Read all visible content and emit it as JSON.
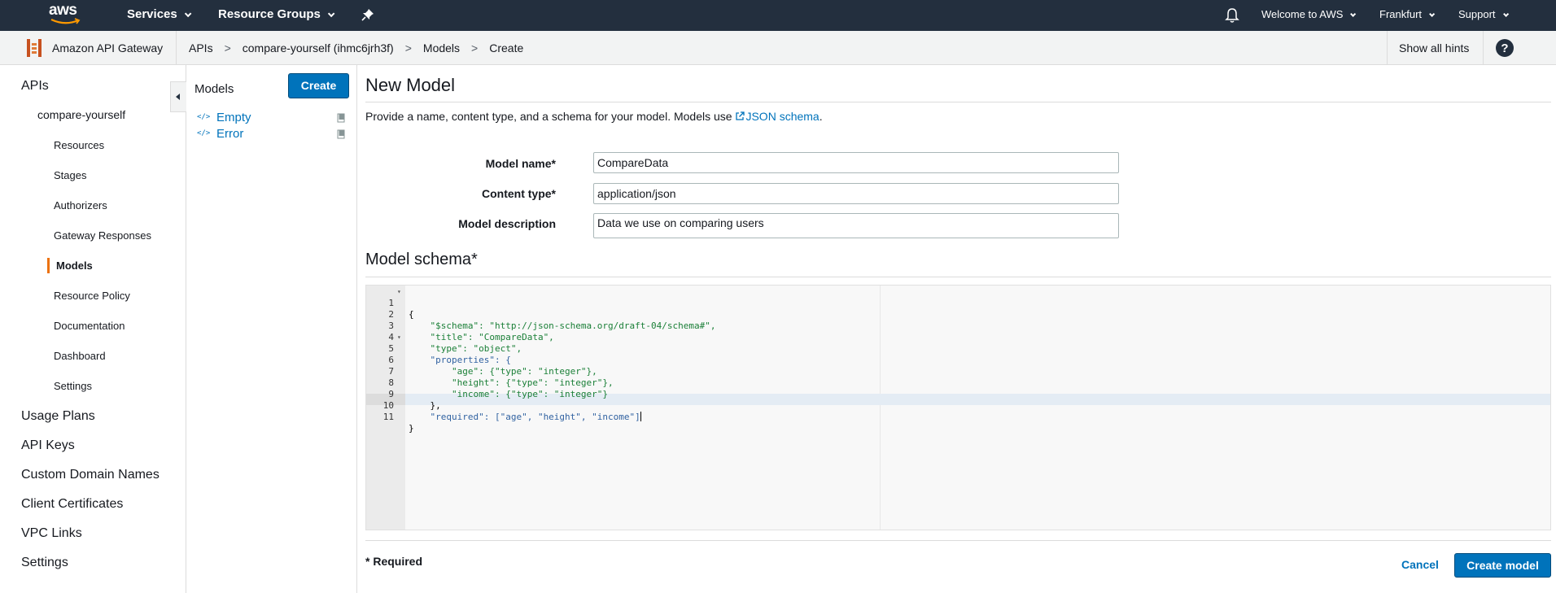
{
  "topnav": {
    "logo_text": "aws",
    "services_label": "Services",
    "resource_groups_label": "Resource Groups",
    "welcome_label": "Welcome to AWS",
    "region_label": "Frankfurt",
    "support_label": "Support"
  },
  "breadcrumb": {
    "service_name": "Amazon API Gateway",
    "items": [
      "APIs",
      "compare-yourself (ihmc6jrh3f)",
      "Models",
      "Create"
    ],
    "separator": ">",
    "hints_label": "Show all hints"
  },
  "sidebar": {
    "items": [
      {
        "label": "APIs",
        "level": 1
      },
      {
        "label": "compare-yourself",
        "level": 2
      },
      {
        "label": "Resources",
        "level": 3
      },
      {
        "label": "Stages",
        "level": 3
      },
      {
        "label": "Authorizers",
        "level": 3
      },
      {
        "label": "Gateway Responses",
        "level": 3
      },
      {
        "label": "Models",
        "level": 3,
        "active": true
      },
      {
        "label": "Resource Policy",
        "level": 3
      },
      {
        "label": "Documentation",
        "level": 3
      },
      {
        "label": "Dashboard",
        "level": 3
      },
      {
        "label": "Settings",
        "level": 3
      },
      {
        "label": "Usage Plans",
        "level": 1
      },
      {
        "label": "API Keys",
        "level": 1
      },
      {
        "label": "Custom Domain Names",
        "level": 1
      },
      {
        "label": "Client Certificates",
        "level": 1
      },
      {
        "label": "VPC Links",
        "level": 1
      },
      {
        "label": "Settings",
        "level": 1
      }
    ]
  },
  "models_panel": {
    "title": "Models",
    "create_label": "Create",
    "models": [
      {
        "name": "Empty",
        "icon": "code-icon"
      },
      {
        "name": "Error",
        "icon": "code-icon"
      }
    ]
  },
  "main": {
    "title": "New Model",
    "intro_text": "Provide a name, content type, and a schema for your model. Models use ",
    "intro_link": "JSON schema",
    "intro_end": ".",
    "fields": {
      "model_name_label": "Model name*",
      "model_name_value": "CompareData",
      "content_type_label": "Content type*",
      "content_type_value": "application/json",
      "description_label": "Model description",
      "description_value": "Data we use on comparing users"
    },
    "schema_title": "Model schema*",
    "schema_lines": [
      "{",
      "    \"$schema\": \"http://json-schema.org/draft-04/schema#\",",
      "    \"title\": \"CompareData\",",
      "    \"type\": \"object\",",
      "    \"properties\": {",
      "        \"age\": {\"type\": \"integer\"},",
      "        \"height\": {\"type\": \"integer\"},",
      "        \"income\": {\"type\": \"integer\"}",
      "    },",
      "    \"required\": [\"age\", \"height\", \"income\"]",
      "}"
    ],
    "required_note": "* Required",
    "cancel_label": "Cancel",
    "create_model_label": "Create model"
  },
  "colors": {
    "topnav_bg": "#232f3e",
    "primary_blue": "#0073bb",
    "active_orange": "#ec7211"
  }
}
